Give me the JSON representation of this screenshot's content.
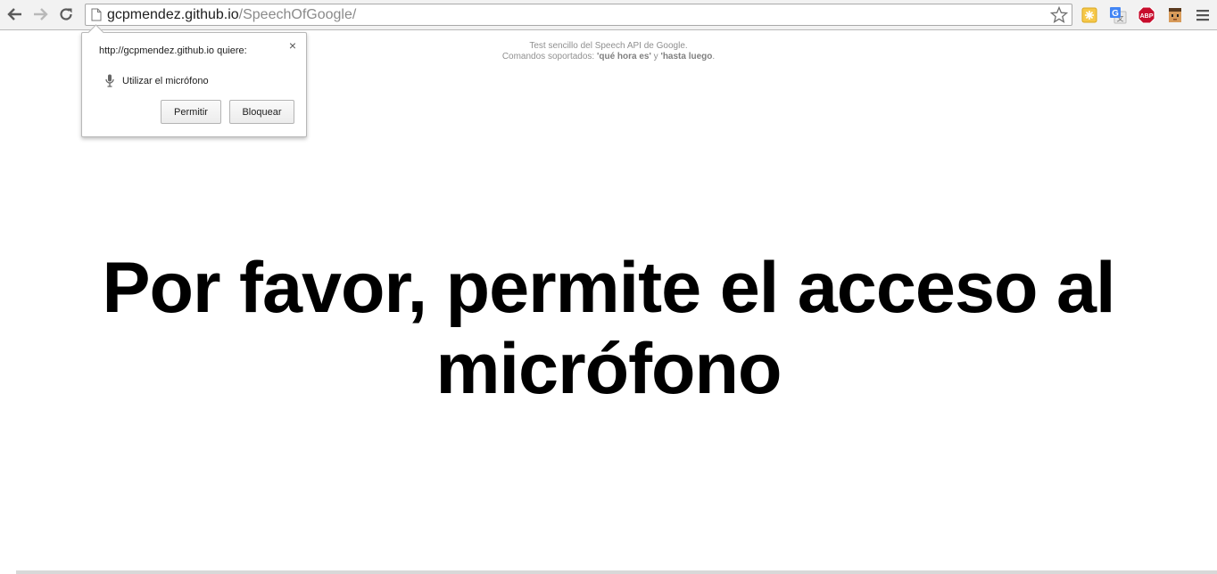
{
  "browser": {
    "url_host": "gcpmendez.github.io",
    "url_path": "/SpeechOfGoogle/",
    "extensions": [
      {
        "name": "sticky-note-icon",
        "color": "#f4c430"
      },
      {
        "name": "google-translate-icon",
        "color": "#4285f4"
      },
      {
        "name": "adblock-plus-icon",
        "label": "ABP",
        "color": "#c70d2c"
      },
      {
        "name": "character-face-icon",
        "color": "#d89b5a"
      }
    ]
  },
  "permission_bubble": {
    "title": "http://gcpmendez.github.io quiere:",
    "permission_label": "Utilizar el micrófono",
    "close_glyph": "×",
    "allow_label": "Permitir",
    "block_label": "Bloquear"
  },
  "page": {
    "subtitle_line1": "Test sencillo del Speech API de Google.",
    "subtitle_line2_prefix": "Comandos soportados: ",
    "command1": "'qué hora es'",
    "subtitle_join": " y ",
    "command2": "'hasta luego",
    "subtitle_end": ".",
    "headline_line1": "Por favor, permite el acceso al",
    "headline_line2": "micrófono"
  }
}
